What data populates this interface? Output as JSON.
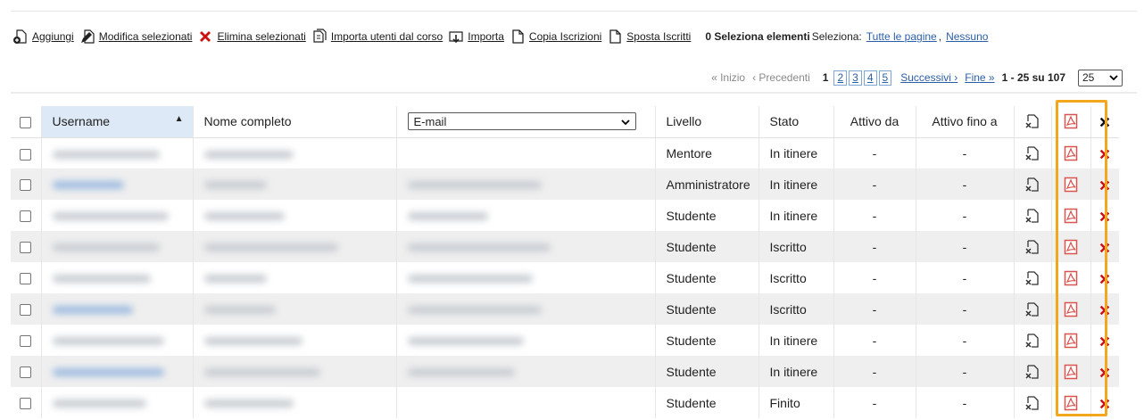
{
  "toolbar": {
    "add_label": "Aggiungi",
    "edit_label": "Modifica selezionati",
    "delete_label": "Elimina selezionati",
    "import_course_label": "Importa utenti dal corso",
    "import_label": "Importa",
    "copy_label": "Copia Iscrizioni",
    "move_label": "Sposta Iscritti",
    "selection_count": "0 Seleziona elementi",
    "select_label": "Seleziona:",
    "select_all_label": "Tutte le pagine",
    "select_sep": ",",
    "select_none_label": "Nessuno"
  },
  "pager": {
    "first_label": "« Inizio",
    "prev_label": "‹ Precedenti",
    "current_page": "1",
    "pages": [
      "2",
      "3",
      "4",
      "5"
    ],
    "next_label": "Successivi ›",
    "last_label": "Fine »",
    "range": "1 - 25 su 107",
    "per_page": "25"
  },
  "table": {
    "headers": {
      "username": "Username",
      "fullname": "Nome completo",
      "email_select": "E-mail",
      "level": "Livello",
      "state": "Stato",
      "active_from": "Attivo da",
      "active_until": "Attivo fino a"
    },
    "rows": [
      {
        "level": "Mentore",
        "state": "In itinere",
        "active_from": "-",
        "active_until": "-"
      },
      {
        "level": "Amministratore",
        "state": "In itinere",
        "active_from": "-",
        "active_until": "-"
      },
      {
        "level": "Studente",
        "state": "In itinere",
        "active_from": "-",
        "active_until": "-"
      },
      {
        "level": "Studente",
        "state": "Iscritto",
        "active_from": "-",
        "active_until": "-"
      },
      {
        "level": "Studente",
        "state": "Iscritto",
        "active_from": "-",
        "active_until": "-"
      },
      {
        "level": "Studente",
        "state": "Iscritto",
        "active_from": "-",
        "active_until": "-"
      },
      {
        "level": "Studente",
        "state": "In itinere",
        "active_from": "-",
        "active_until": "-"
      },
      {
        "level": "Studente",
        "state": "In itinere",
        "active_from": "-",
        "active_until": "-"
      },
      {
        "level": "Studente",
        "state": "Finito",
        "active_from": "-",
        "active_until": "-"
      }
    ]
  },
  "icons": {
    "add": "add-user-icon",
    "edit": "edit-icon",
    "delete": "delete-x-icon",
    "import_course": "copy-document-icon",
    "import": "import-icon",
    "copy": "document-icon",
    "move": "document-icon",
    "row_action_1": "document-x-icon",
    "row_action_2": "pdf-icon",
    "row_action_3": "delete-x-icon"
  },
  "colors": {
    "link": "#2b5fa6",
    "delete_red": "#cc1111",
    "pdf_red": "#d9534f",
    "highlight": "#f2a71c",
    "sorted_header": "#dde9f7",
    "stripe": "#efefef"
  }
}
